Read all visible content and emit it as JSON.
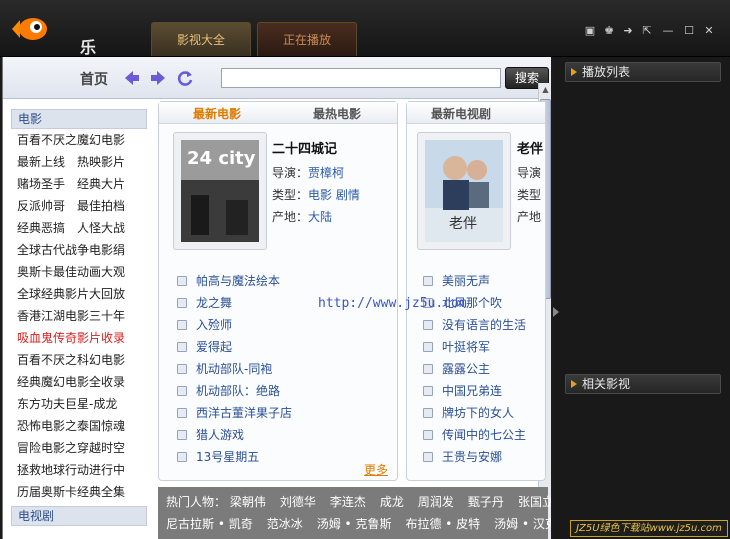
{
  "app": {
    "name": "乐鱼"
  },
  "top_tabs": [
    {
      "label": "影视大全"
    },
    {
      "label": "正在播放"
    }
  ],
  "window_controls": [
    "menu-icon",
    "skin-icon",
    "mini-icon",
    "restore-icon",
    "minimize-icon",
    "maximize-icon",
    "close-icon"
  ],
  "nav": {
    "home": "首页",
    "search_button": "搜索"
  },
  "categories": {
    "movie_header": "电影",
    "rows": [
      [
        "百看不厌之魔幻电影"
      ],
      [
        "最新上线",
        "热映影片"
      ],
      [
        "赌场圣手",
        "经典大片"
      ],
      [
        "反派帅哥",
        "最佳拍档"
      ],
      [
        "经典恶搞",
        "人怪大战"
      ],
      [
        "全球古代战争电影绢"
      ],
      [
        "奥斯卡最佳动画大观"
      ],
      [
        "全球经典影片大回放"
      ],
      [
        "香港江湖电影三十年"
      ],
      [
        "吸血鬼传奇影片收录"
      ],
      [
        "百看不厌之科幻电影"
      ],
      [
        "经典魔幻电影全收录"
      ],
      [
        "东方功夫巨星-成龙"
      ],
      [
        "恐怖电影之泰国惊魂"
      ],
      [
        "冒险电影之穿越时空"
      ],
      [
        "拯救地球行动进行中"
      ],
      [
        "历届奥斯卡经典全集"
      ]
    ],
    "tv_header": "电视剧"
  },
  "movies": {
    "tab_latest": "最新电影",
    "tab_hottest": "最热电影",
    "featured": {
      "title": "二十四城记",
      "poster_text": "24 city",
      "director_label": "导演：",
      "director": "贾樟柯",
      "type_label": "类型：",
      "type": "电影 剧情",
      "region_label": "产地：",
      "region": "大陆"
    },
    "list": [
      "帕高与魔法绘本",
      "龙之舞",
      "入殓师",
      "爱得起",
      "机动部队-同袍",
      "机动部队：绝路",
      "西洋古董洋果子店",
      "猎人游戏",
      "13号星期五"
    ],
    "more": "更多"
  },
  "tv": {
    "tab": "最新电视剧",
    "featured": {
      "title": "老伴",
      "poster_text": "老伴",
      "director_label": "导演",
      "type_label": "类型",
      "region_label": "产地"
    },
    "list": [
      "美丽无声",
      "北风那个吹",
      "没有语言的生活",
      "叶挺将军",
      "露露公主",
      "中国兄弟连",
      "牌坊下的女人",
      "传闻中的七公主",
      "王贵与安娜"
    ]
  },
  "hot_people": {
    "label": "热门人物：",
    "row1": [
      "梁朝伟",
      "刘德华",
      "李连杰",
      "成龙",
      "周润发",
      "甄子丹",
      "张国立"
    ],
    "row2": [
      "尼古拉斯 • 凯奇",
      "范冰冰",
      "汤姆 • 克鲁斯",
      "布拉德 • 皮特",
      "汤姆 • 汉克"
    ]
  },
  "right_panel": {
    "playlist": "播放列表",
    "related": "相关影视"
  },
  "overlay": {
    "url": "http://www.jz5u.com",
    "badge": "JZ5U绿色下载站www.jz5u.com"
  }
}
